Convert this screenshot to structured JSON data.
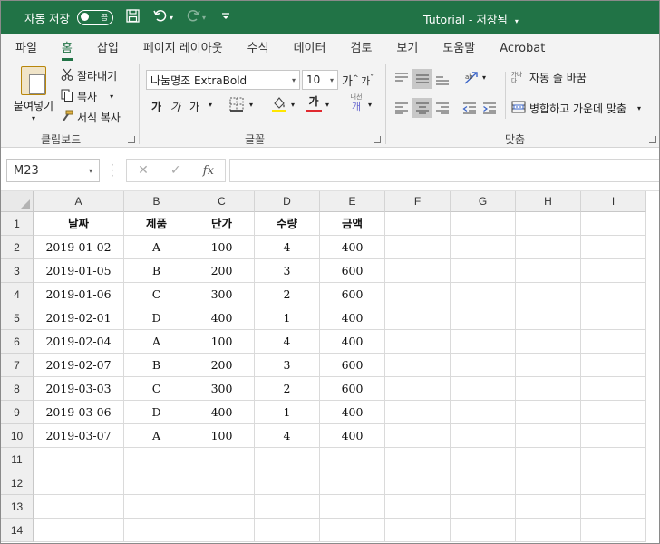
{
  "titlebar": {
    "autosave_label": "자동 저장",
    "autosave_toggle": "끔",
    "doc_title": "Tutorial  -  저장됨"
  },
  "tabs": [
    "파일",
    "홈",
    "삽입",
    "페이지 레이아웃",
    "수식",
    "데이터",
    "검토",
    "보기",
    "도움말",
    "Acrobat"
  ],
  "active_tab": "홈",
  "ribbon": {
    "clipboard": {
      "paste_label": "붙여넣기",
      "cut_label": "잘라내기",
      "copy_label": "복사",
      "format_painter_label": "서식 복사",
      "group_label": "클립보드"
    },
    "font": {
      "font_name": "나눔명조 ExtraBold",
      "font_size": "10",
      "increase_size": "가",
      "decrease_size": "가",
      "bold": "가",
      "italic": "가",
      "underline": "가",
      "font_color_glyph": "가",
      "phonetic_top": "내선",
      "phonetic_bottom": "개",
      "group_label": "글꼴"
    },
    "alignment": {
      "wrap_text_label": "자동 줄 바꿈",
      "wrap_text_icon_text": "가나\n다",
      "merge_center_label": "병합하고 가운데 맞춤",
      "group_label": "맞춤"
    }
  },
  "formula_bar": {
    "name_box": "M23",
    "fx": "fx",
    "content": ""
  },
  "sheet": {
    "columns": [
      "A",
      "B",
      "C",
      "D",
      "E",
      "F",
      "G",
      "H",
      "I"
    ],
    "row_numbers": [
      "1",
      "2",
      "3",
      "4",
      "5",
      "6",
      "7",
      "8",
      "9",
      "10",
      "11",
      "12",
      "13",
      "14"
    ],
    "header": [
      "날짜",
      "제품",
      "단가",
      "수량",
      "금액"
    ],
    "rows": [
      [
        "2019-01-02",
        "A",
        "100",
        "4",
        "400"
      ],
      [
        "2019-01-05",
        "B",
        "200",
        "3",
        "600"
      ],
      [
        "2019-01-06",
        "C",
        "300",
        "2",
        "600"
      ],
      [
        "2019-02-01",
        "D",
        "400",
        "1",
        "400"
      ],
      [
        "2019-02-04",
        "A",
        "100",
        "4",
        "400"
      ],
      [
        "2019-02-07",
        "B",
        "200",
        "3",
        "600"
      ],
      [
        "2019-03-03",
        "C",
        "300",
        "2",
        "600"
      ],
      [
        "2019-03-06",
        "D",
        "400",
        "1",
        "400"
      ],
      [
        "2019-03-07",
        "A",
        "100",
        "4",
        "400"
      ]
    ]
  },
  "colors": {
    "brand_green": "#217346",
    "font_color_accent": "#e0292f",
    "highlight_accent": "#ffe600"
  }
}
